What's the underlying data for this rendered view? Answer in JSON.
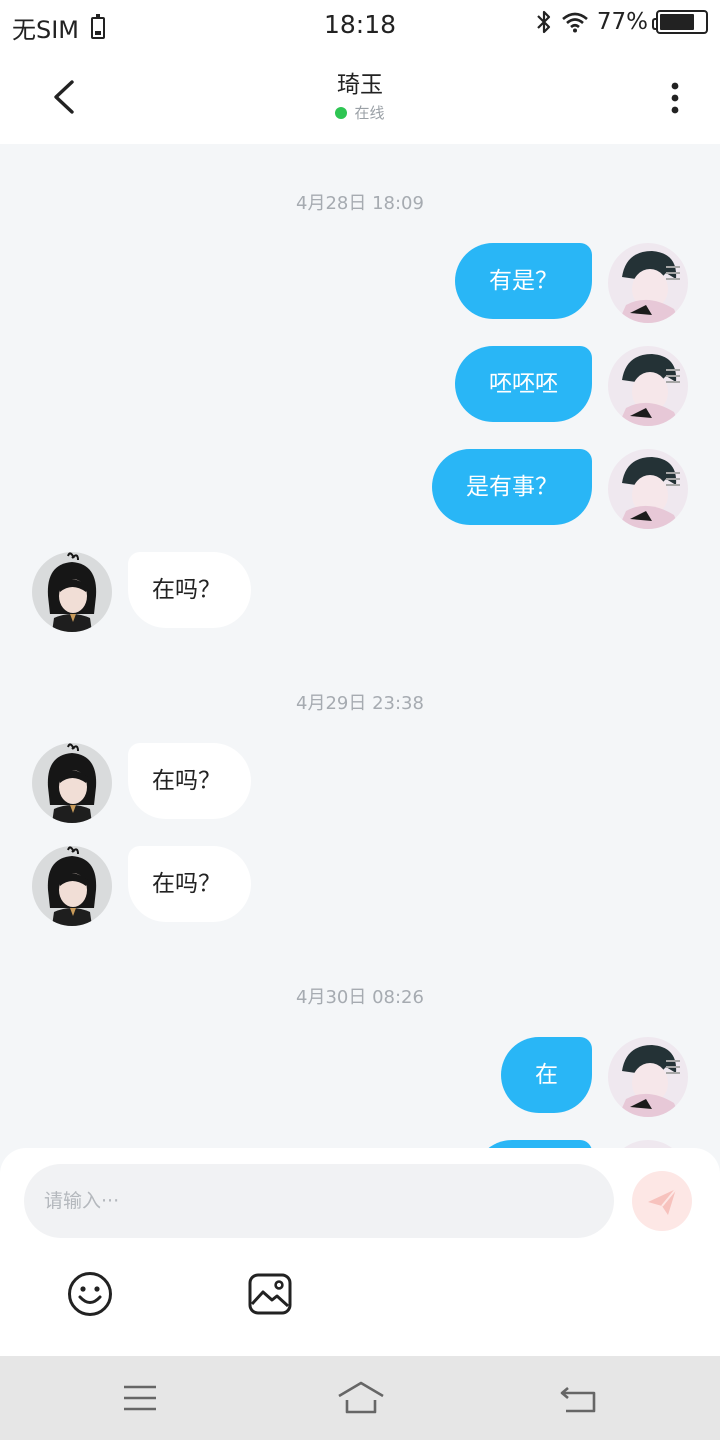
{
  "status_bar": {
    "carrier": "无SIM",
    "time": "18:18",
    "battery_percent": "77%",
    "battery_level": 0.77,
    "icons": [
      "sim-card-icon",
      "bluetooth-icon",
      "wifi-icon",
      "battery-icon"
    ]
  },
  "header": {
    "title": "琦玉",
    "status": "在线",
    "status_color": "#2ec553",
    "icons": [
      "back-chevron-icon",
      "more-vertical-icon"
    ]
  },
  "chat": {
    "outgoing_bubble_color": "#29b6f6",
    "incoming_bubble_color": "#ffffff",
    "timestamps": [
      "4月28日 18:09",
      "4月29日 23:38",
      "4月30日 08:26"
    ],
    "messages": [
      {
        "side": "right",
        "text": "有是？"
      },
      {
        "side": "right",
        "text": "呸呸呸"
      },
      {
        "side": "right",
        "text": "是有事？"
      },
      {
        "side": "left",
        "text": "在吗？"
      },
      {
        "side": "left",
        "text": "在吗？"
      },
      {
        "side": "left",
        "text": "在吗？"
      },
      {
        "side": "right",
        "text": "在"
      }
    ]
  },
  "composer": {
    "placeholder": "请输入···",
    "icons": [
      "send-plane-icon",
      "emoji-smile-icon",
      "image-picture-icon"
    ]
  },
  "nav_bar": {
    "icons": [
      "menu-icon",
      "home-icon",
      "back-icon"
    ]
  }
}
